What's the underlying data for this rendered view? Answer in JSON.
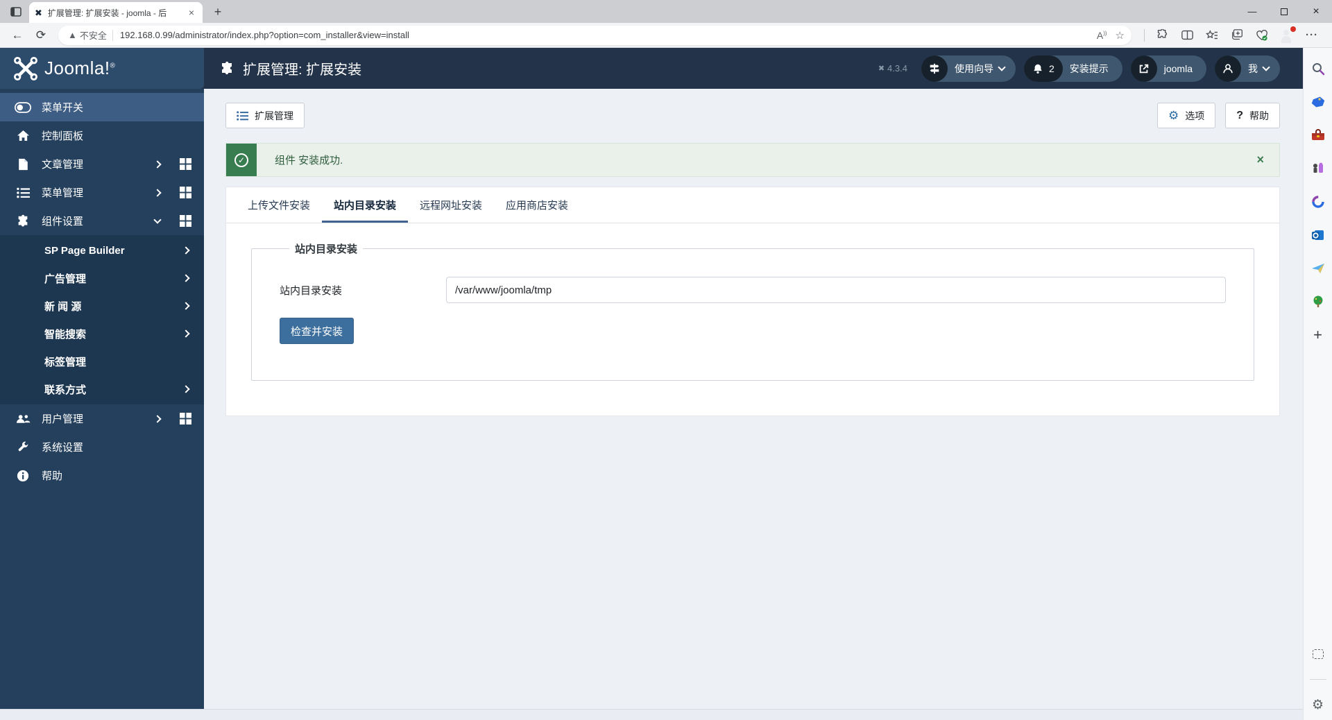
{
  "browser": {
    "tab_title": "扩展管理: 扩展安装 - joomla - 后",
    "tab_close": "×",
    "new_tab": "+",
    "back": "←",
    "reload": "⟳",
    "security_label": "不安全",
    "url": "192.168.0.99/administrator/index.php?option=com_installer&view=install",
    "read_aloud": "A",
    "window": {
      "minimize": "—",
      "close": "×"
    }
  },
  "header": {
    "logo_text": "Joomla!",
    "logo_sup": "®",
    "page_title": "扩展管理: 扩展安装",
    "version": "4.3.4",
    "guide_pill": "使用向导",
    "notice_badge": "2",
    "notice_pill": "安装提示",
    "site_pill": "joomla",
    "me_pill": "我"
  },
  "sidebar": {
    "items": [
      {
        "label": "菜单开关"
      },
      {
        "label": "控制面板"
      },
      {
        "label": "文章管理"
      },
      {
        "label": "菜单管理"
      },
      {
        "label": "组件设置"
      },
      {
        "label": "用户管理"
      },
      {
        "label": "系统设置"
      },
      {
        "label": "帮助"
      }
    ],
    "submenu": [
      {
        "label": "SP Page Builder"
      },
      {
        "label": "广告管理"
      },
      {
        "label": "新 闻 源"
      },
      {
        "label": "智能搜索"
      },
      {
        "label": "标签管理"
      },
      {
        "label": "联系方式"
      }
    ]
  },
  "toolbar": {
    "extensions_button": "扩展管理",
    "options_button": "选项",
    "help_button": "帮助",
    "help_glyph": "?"
  },
  "alert": {
    "message": "组件 安装成功.",
    "check": "✓",
    "close": "×"
  },
  "tabs": [
    {
      "label": "上传文件安装"
    },
    {
      "label": "站内目录安装"
    },
    {
      "label": "远程网址安装"
    },
    {
      "label": "应用商店安装"
    }
  ],
  "form": {
    "legend": "站内目录安装",
    "field_label": "站内目录安装",
    "field_value": "/var/www/joomla/tmp",
    "submit_label": "检查并安装"
  },
  "icons": {
    "rail": [
      "search-icon",
      "shopping-tag-icon",
      "toolbox-icon",
      "games-icon",
      "m365-icon",
      "outlook-icon",
      "drop-plane-icon",
      "tree-icon",
      "plus-icon",
      "web-capture-icon",
      "settings-gear-icon"
    ],
    "gear": "⚙"
  },
  "colors": {
    "header_bg": "#22334a",
    "logo_band_bg": "#2d4b6b",
    "sidebar_bg": "#24405d",
    "sidebar_active_bg": "#3d5d84",
    "submenu_bg": "#1d3751",
    "accent_blue": "#3d6f9e",
    "success_green": "#377d4f",
    "page_bg": "#edf0f5"
  }
}
